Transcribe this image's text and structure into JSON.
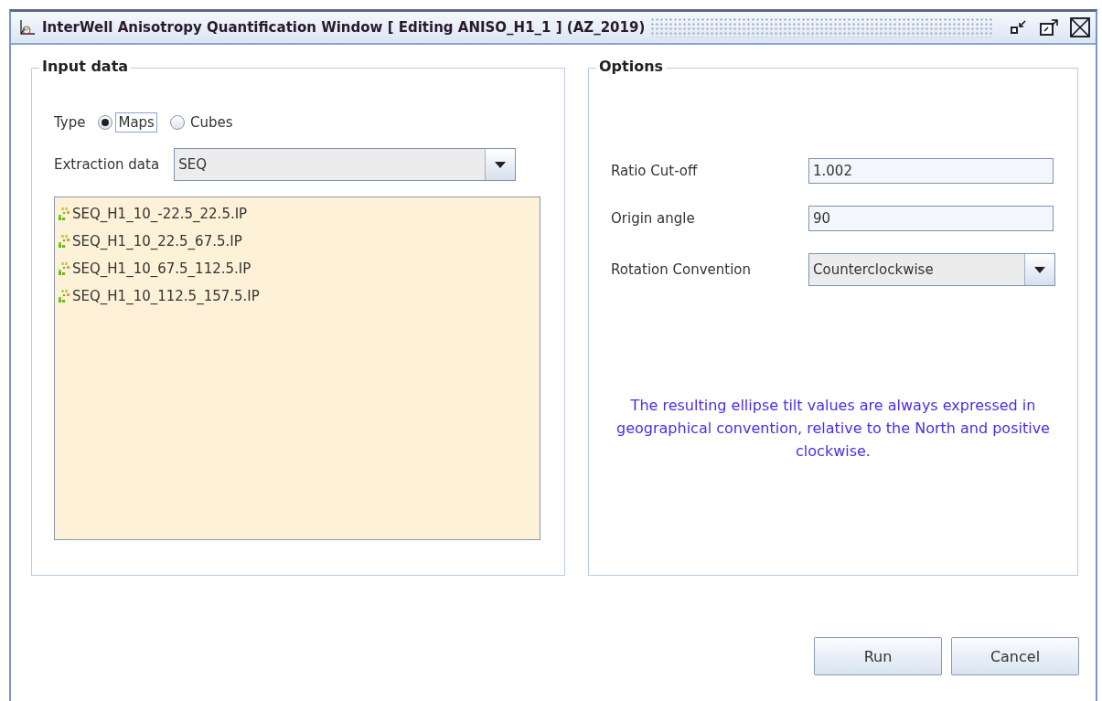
{
  "window": {
    "title": "InterWell Anisotropy Quantification Window [ Editing ANISO_H1_1 ] (AZ_2019)"
  },
  "input_data": {
    "title": "Input data",
    "type": {
      "label": "Type",
      "options": [
        {
          "label": "Maps",
          "selected": true,
          "focused": true
        },
        {
          "label": "Cubes",
          "selected": false,
          "focused": false
        }
      ]
    },
    "extraction": {
      "label": "Extraction data",
      "value": "SEQ"
    },
    "items": [
      {
        "label": "SEQ_H1_10_-22.5_22.5.IP"
      },
      {
        "label": "SEQ_H1_10_22.5_67.5.IP"
      },
      {
        "label": "SEQ_H1_10_67.5_112.5.IP"
      },
      {
        "label": "SEQ_H1_10_112.5_157.5.IP"
      }
    ]
  },
  "options": {
    "title": "Options",
    "fields": [
      {
        "kind": "text",
        "label": "Ratio Cut-off",
        "value": "1.002"
      },
      {
        "kind": "text",
        "label": "Origin angle",
        "value": "90"
      },
      {
        "kind": "combo",
        "label": "Rotation Convention",
        "value": "Counterclockwise"
      }
    ],
    "note": "The resulting ellipse tilt values are always expressed in geographical convention, relative to the North and positive clockwise."
  },
  "buttons": [
    {
      "label": "Run"
    },
    {
      "label": "Cancel"
    }
  ]
}
